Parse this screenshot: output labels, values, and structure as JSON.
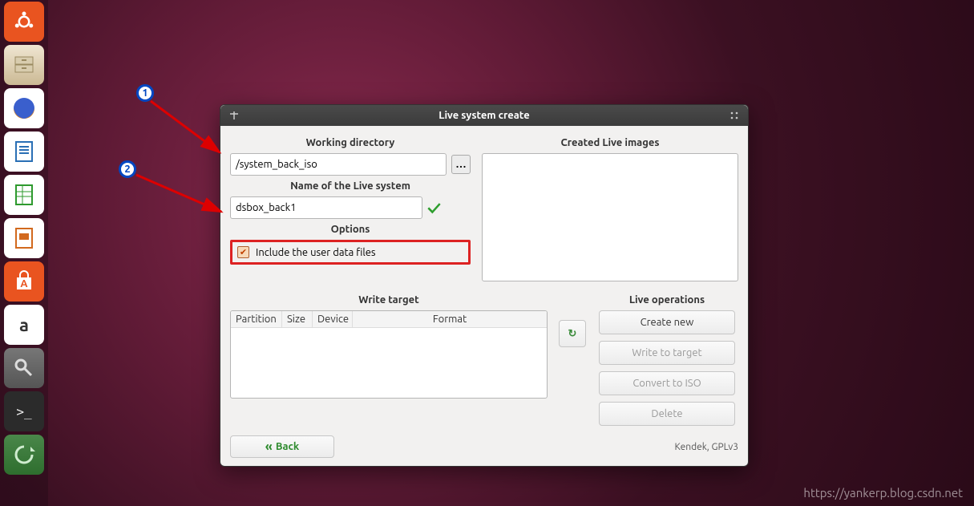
{
  "launcher": {
    "items": [
      {
        "name": "ubuntu-dash"
      },
      {
        "name": "file-manager"
      },
      {
        "name": "firefox"
      },
      {
        "name": "libreoffice-writer"
      },
      {
        "name": "libreoffice-calc"
      },
      {
        "name": "libreoffice-impress"
      },
      {
        "name": "ubuntu-software"
      },
      {
        "name": "amazon"
      },
      {
        "name": "system-settings"
      },
      {
        "name": "terminal"
      },
      {
        "name": "recycle-update"
      }
    ]
  },
  "window": {
    "title": "Live system create",
    "left_col": {
      "working_dir_label": "Working directory",
      "working_dir_value": "/system_back_iso",
      "name_label": "Name of the Live system",
      "name_value": "dsbox_back1",
      "options_label": "Options",
      "include_user_data_label": "Include the user data files",
      "include_user_data_checked": true
    },
    "right_col": {
      "created_images_label": "Created Live images"
    },
    "write_target": {
      "label": "Write target",
      "columns": [
        "Partition",
        "Size",
        "Device",
        "Format"
      ]
    },
    "operations": {
      "label": "Live operations",
      "create": "Create new",
      "write": "Write to target",
      "convert": "Convert to ISO",
      "delete": "Delete"
    },
    "back_label": "Back",
    "credit": "Kendek, GPLv3"
  },
  "annotations": {
    "marker1": "1",
    "marker2": "2"
  },
  "watermark": "https://yankerp.blog.csdn.net"
}
